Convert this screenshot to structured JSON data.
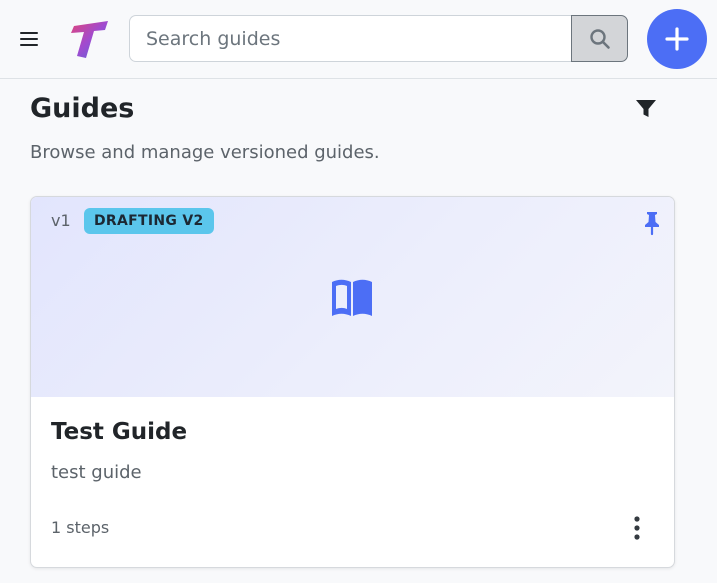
{
  "header": {
    "menu_icon": "hamburger-menu-icon",
    "logo_icon": "app-logo",
    "search": {
      "placeholder": "Search guides",
      "value": "",
      "button_icon": "search-icon"
    },
    "add_icon": "plus-icon",
    "accent_color": "#4c6ef5"
  },
  "page": {
    "title": "Guides",
    "subtitle": "Browse and manage versioned guides.",
    "filter_icon": "filter-icon"
  },
  "guides": [
    {
      "version": "v1",
      "status": "DRAFTING V2",
      "status_color": "#5bc6ec",
      "pinned": true,
      "cover_icon": "open-book-icon",
      "title": "Test Guide",
      "description": "test guide",
      "steps": "1 steps",
      "menu_icon": "more-vertical-icon"
    }
  ]
}
